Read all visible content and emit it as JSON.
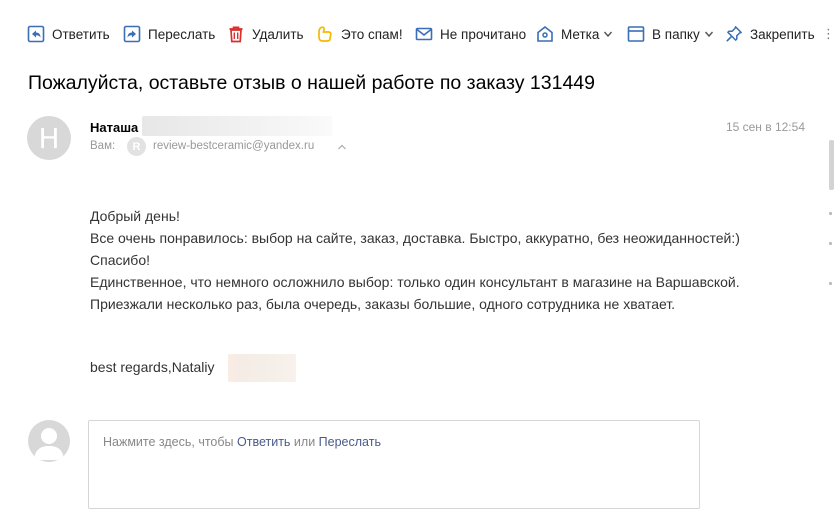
{
  "toolbar": {
    "reply": "Ответить",
    "forward": "Переслать",
    "delete": "Удалить",
    "spam": "Это спам!",
    "unread": "Не прочитано",
    "label": "Метка",
    "folder": "В папку",
    "pin": "Закрепить"
  },
  "message": {
    "subject": "Пожалуйста, оставьте отзыв о нашей работе по заказу 131449",
    "sender_initial": "Н",
    "sender_name": "Наташа",
    "to_label": "Вам:",
    "to_initial": "R",
    "to_address": "review-bestceramic@yandex.ru",
    "date": "15 сен в 12:54",
    "body": [
      "Добрый день!",
      "Все очень понравилось: выбор на сайте, заказ, доставка. Быстро, аккуратно, без неожиданностей:)",
      "Спасибо!",
      "Единственное, что немного осложнило выбор: только один консультант в магазине на Варшавской.",
      "Приезжали несколько раз, была очередь, заказы большие, одного сотрудника не хватает."
    ],
    "signature": "best regards,Nataliy"
  },
  "quick_reply": {
    "prefix": "Нажмите здесь, чтобы ",
    "reply_link": "Ответить",
    "middle": " или ",
    "forward_link": "Переслать"
  },
  "colors": {
    "icon_blue": "#3a6eb5",
    "delete_red": "#d9302c",
    "spam_yellow": "#f5b800",
    "link": "#4a5a8a"
  }
}
